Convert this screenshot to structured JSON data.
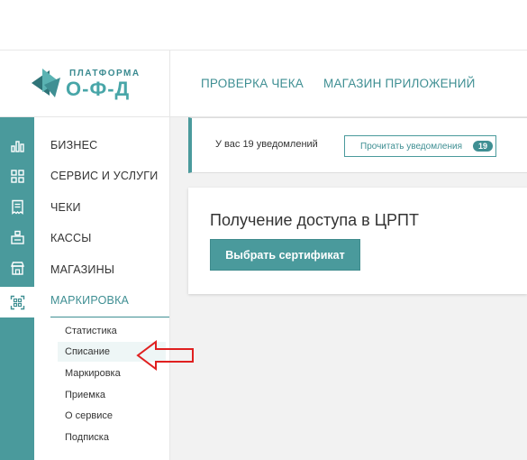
{
  "logo": {
    "top": "ПЛАТФОРМА",
    "main": "О-Ф-Д"
  },
  "header": {
    "links": [
      "ПРОВЕРКА ЧЕКА",
      "МАГАЗИН ПРИЛОЖЕНИЙ"
    ]
  },
  "rail": {
    "icons": [
      "bar-chart-icon",
      "grid-icon",
      "receipt-icon",
      "register-icon",
      "store-icon",
      "qr-scan-icon"
    ],
    "active": "qr-scan-icon"
  },
  "nav": {
    "items": [
      "БИЗНЕС",
      "СЕРВИС И УСЛУГИ",
      "ЧЕКИ",
      "КАССЫ",
      "МАГАЗИНЫ",
      "МАРКИРОВКА"
    ],
    "active": "МАРКИРОВКА",
    "subitems": [
      "Статистика",
      "Списание",
      "Маркировка",
      "Приемка",
      "О сервисе",
      "Подписка"
    ],
    "selected_subitem": "Списание"
  },
  "notifications": {
    "text": "У вас 19 уведомлений",
    "button_label": "Прочитать уведомления",
    "count": "19"
  },
  "access_card": {
    "title": "Получение доступа в ЦРПТ",
    "button_label": "Выбрать сертификат"
  },
  "colors": {
    "accent": "#4a9a9c",
    "accent_text": "#3f8f93",
    "annotation_arrow": "#e02020"
  }
}
